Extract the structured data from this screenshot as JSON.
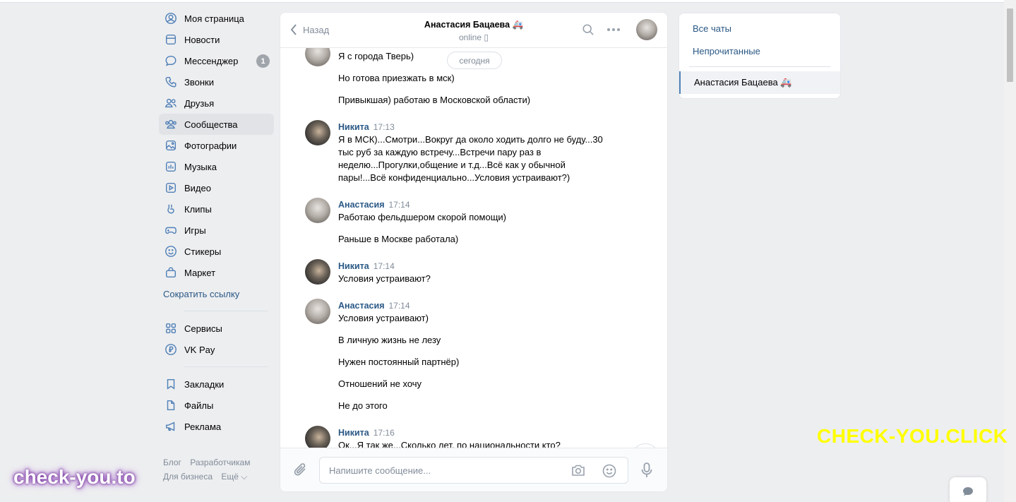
{
  "leftnav": {
    "items": [
      {
        "label": "Моя страница",
        "icon": "user-circle-icon"
      },
      {
        "label": "Новости",
        "icon": "newspaper-icon"
      },
      {
        "label": "Мессенджер",
        "icon": "message-icon",
        "badge": "1"
      },
      {
        "label": "Звонки",
        "icon": "phone-icon"
      },
      {
        "label": "Друзья",
        "icon": "friends-icon"
      },
      {
        "label": "Сообщества",
        "icon": "communities-icon"
      },
      {
        "label": "Фотографии",
        "icon": "photo-icon"
      },
      {
        "label": "Музыка",
        "icon": "music-icon"
      },
      {
        "label": "Видео",
        "icon": "video-icon"
      },
      {
        "label": "Клипы",
        "icon": "clips-icon"
      },
      {
        "label": "Игры",
        "icon": "gamepad-icon"
      },
      {
        "label": "Стикеры",
        "icon": "smile-icon"
      },
      {
        "label": "Маркет",
        "icon": "bag-icon"
      }
    ],
    "shorten_link": "Сократить ссылку",
    "services": [
      {
        "label": "Сервисы",
        "icon": "grid-icon"
      },
      {
        "label": "VK Pay",
        "icon": "ruble-icon"
      }
    ],
    "extra": [
      {
        "label": "Закладки",
        "icon": "bookmark-icon"
      },
      {
        "label": "Файлы",
        "icon": "file-icon"
      },
      {
        "label": "Реклама",
        "icon": "megaphone-icon"
      }
    ],
    "footer": {
      "blog": "Блог",
      "dev": "Разработчикам",
      "business": "Для бизнеса",
      "more": "Ещё ⌵"
    }
  },
  "chat": {
    "back_label": "Назад",
    "peer_name": "Анастасия Бацаева 🚑",
    "peer_status": "online",
    "today": "сегодня",
    "messages": {
      "m1": {
        "text": "Я с города Тверь)"
      },
      "m2": {
        "text": "Но готова приезжать в мск)"
      },
      "m3": {
        "text": "Привыкшая) работаю в Московской области)"
      },
      "m4": {
        "author": "Никита",
        "time": "17:13",
        "text": "Я в МСК)...Смотри...Вокруг да около ходить долго не буду...30 тыс руб за каждую встречу...Встречи пару раз в неделю...Прогулки,общение и т.д...Всё как у обычной пары!...Всё конфиденциально...Условия устраивают?)"
      },
      "m5": {
        "author": "Анастасия",
        "time": "17:14",
        "text": "Работаю фельдшером скорой помощи)"
      },
      "m6": {
        "text": "Раньше в Москве работала)"
      },
      "m7": {
        "author": "Никита",
        "time": "17:14",
        "text": "Условия устраивают?"
      },
      "m8": {
        "author": "Анастасия",
        "time": "17:14",
        "text": "Условия устраивают)"
      },
      "m9": {
        "text": "В личную жизнь не лезу"
      },
      "m10": {
        "text": "Нужен постоянный партнёр)"
      },
      "m11": {
        "text": "Отношений не хочу"
      },
      "m12": {
        "text": "Не до этого"
      },
      "m13": {
        "author": "Никита",
        "time": "17:16",
        "text": "Ок...Я так же...Сколько лет, по национальности кто?"
      }
    },
    "composer_placeholder": "Напишите сообщение..."
  },
  "rightpanel": {
    "all_chats": "Все чаты",
    "unread": "Непрочитанные",
    "active_chat": "Анастасия Бацаева 🚑"
  },
  "watermarks": {
    "right": "CHECK-YOU.CLICK",
    "left": "check-you.to"
  },
  "colors": {
    "accent": "#2a5885",
    "background": "#edeef0",
    "watermark_yellow": "#ffff00"
  }
}
